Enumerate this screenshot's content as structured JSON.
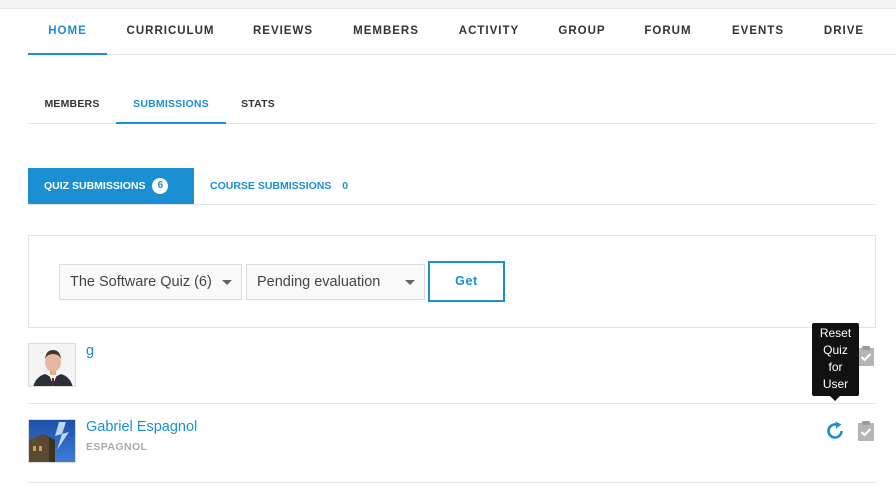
{
  "main_nav": {
    "items": [
      "HOME",
      "CURRICULUM",
      "REVIEWS",
      "MEMBERS",
      "ACTIVITY",
      "GROUP",
      "FORUM",
      "EVENTS",
      "DRIVE"
    ],
    "active": "HOME"
  },
  "sub_nav": {
    "items": [
      "MEMBERS",
      "SUBMISSIONS",
      "STATS"
    ],
    "active": "SUBMISSIONS"
  },
  "submission_tabs": {
    "quiz": {
      "label": "QUIZ SUBMISSIONS",
      "count": "6"
    },
    "course": {
      "label": "COURSE SUBMISSIONS",
      "count": "0"
    }
  },
  "filters": {
    "quiz_select": "The Software Quiz (6)",
    "status_select": "Pending evaluation",
    "get_label": "Get"
  },
  "users": [
    {
      "name": "g",
      "username": "",
      "avatar": "man-in-suit-photo"
    },
    {
      "name": "Gabriel Espagnol",
      "username": "ESPAGNOL",
      "avatar": "lightning-building-photo"
    }
  ],
  "tooltip": {
    "lines": [
      "Reset",
      "Quiz",
      "for",
      "User"
    ]
  },
  "icons": {
    "reset": "refresh-icon",
    "evaluate": "clipboard-check-icon"
  },
  "colors": {
    "accent": "#1a8fd2",
    "text": "#333333",
    "muted": "#aaaaaa"
  }
}
